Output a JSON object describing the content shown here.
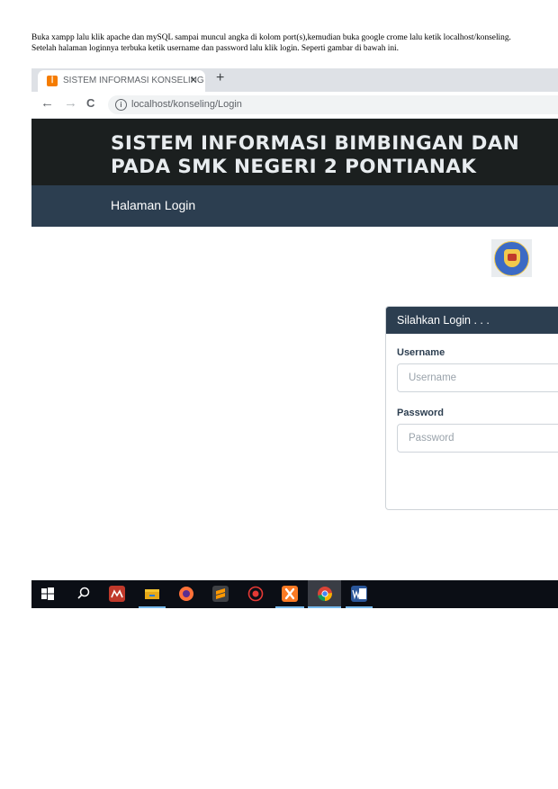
{
  "document": {
    "paragraph": "Buka xampp lalu klik apache dan mySQL sampai muncul angka di kolom port(s),kemudian buka google crome lalu ketik localhost/konseling. Setelah halaman loginnya terbuka ketik username dan password lalu klik login. Seperti gambar di bawah ini."
  },
  "browser": {
    "tab_favicon": "xampp-icon",
    "tab_title": "SISTEM INFORMASI KONSELING",
    "tab_close": "×",
    "new_tab": "+",
    "back": "←",
    "forward": "→",
    "reload": "C",
    "url": "localhost/konseling/Login"
  },
  "site": {
    "title_line1": "SISTEM INFORMASI BIMBINGAN DAN",
    "title_line2": "PADA SMK NEGERI 2 PONTIANAK",
    "nav_login": "Halaman Login",
    "logo": "tut-wuri-handayani-logo"
  },
  "login": {
    "heading": "Silahkan Login . . .",
    "username_label": "Username",
    "username_placeholder": "Username",
    "password_label": "Password",
    "password_placeholder": "Password"
  },
  "taskbar": {
    "icons": [
      "windows-start-icon",
      "search-icon",
      "app-icon",
      "file-explorer-icon",
      "firefox-icon",
      "sublime-text-icon",
      "app-icon",
      "xampp-icon",
      "chrome-icon",
      "word-icon"
    ]
  },
  "colors": {
    "header_bg": "#1b1f1f",
    "nav_bg": "#2c3e50",
    "taskbar_bg": "#0b0e15",
    "tab_accent": "#f57c00"
  }
}
